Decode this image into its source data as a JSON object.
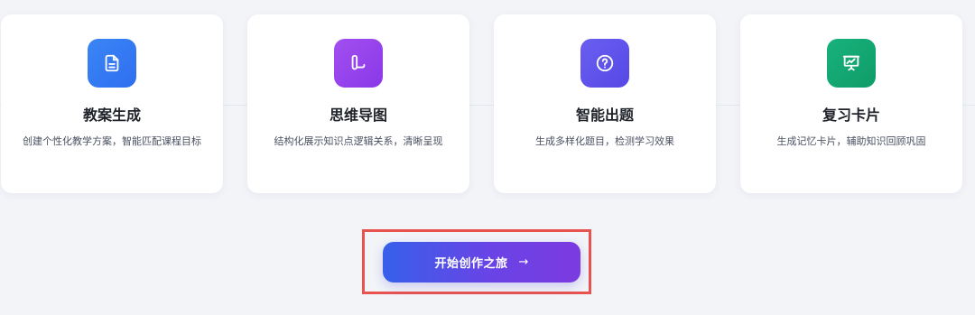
{
  "features": [
    {
      "title": "教案生成",
      "description": "创建个性化教学方案，智能匹配课程目标",
      "icon": "document-icon",
      "gradient": [
        "#3a86f5",
        "#2f6ef0"
      ]
    },
    {
      "title": "思维导图",
      "description": "结构化展示知识点逻辑关系，清晰呈现",
      "icon": "mindmap-icon",
      "gradient": [
        "#a24ff0",
        "#8a38e8"
      ]
    },
    {
      "title": "智能出题",
      "description": "生成多样化题目，检测学习效果",
      "icon": "question-icon",
      "gradient": [
        "#6a5ff0",
        "#5548e6"
      ]
    },
    {
      "title": "复习卡片",
      "description": "生成记忆卡片，辅助知识回顾巩固",
      "icon": "presentation-icon",
      "gradient": [
        "#18b27c",
        "#0f9c69"
      ]
    }
  ],
  "cta": {
    "label": "开始创作之旅",
    "arrow": "→"
  }
}
